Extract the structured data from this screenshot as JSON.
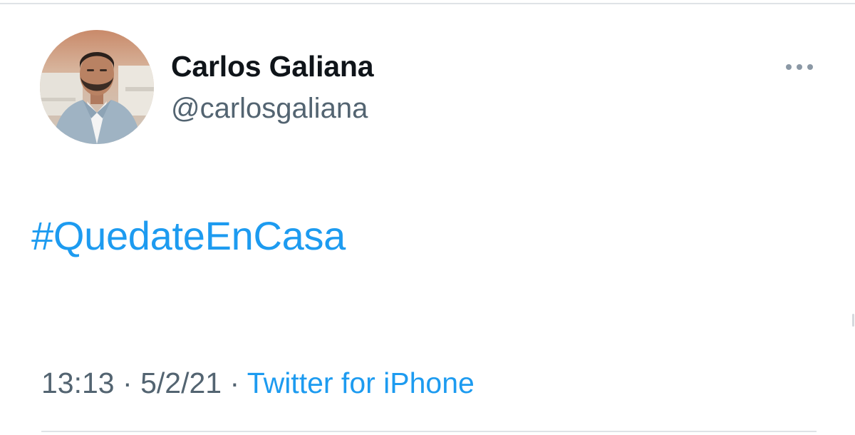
{
  "tweet": {
    "author": {
      "display_name": "Carlos Galiana",
      "handle": "@carlosgaliana",
      "avatar_icon": "profile-photo"
    },
    "text": "#QuedateEnCasa",
    "meta": {
      "time": "13:13",
      "separator": "·",
      "date": "5/2/21",
      "source": "Twitter for iPhone"
    },
    "more_icon": "ellipsis-icon"
  },
  "colors": {
    "link": "#1d9bf0",
    "name": "#0f1419",
    "secondary": "#536471",
    "divider": "#dfe3e7"
  }
}
